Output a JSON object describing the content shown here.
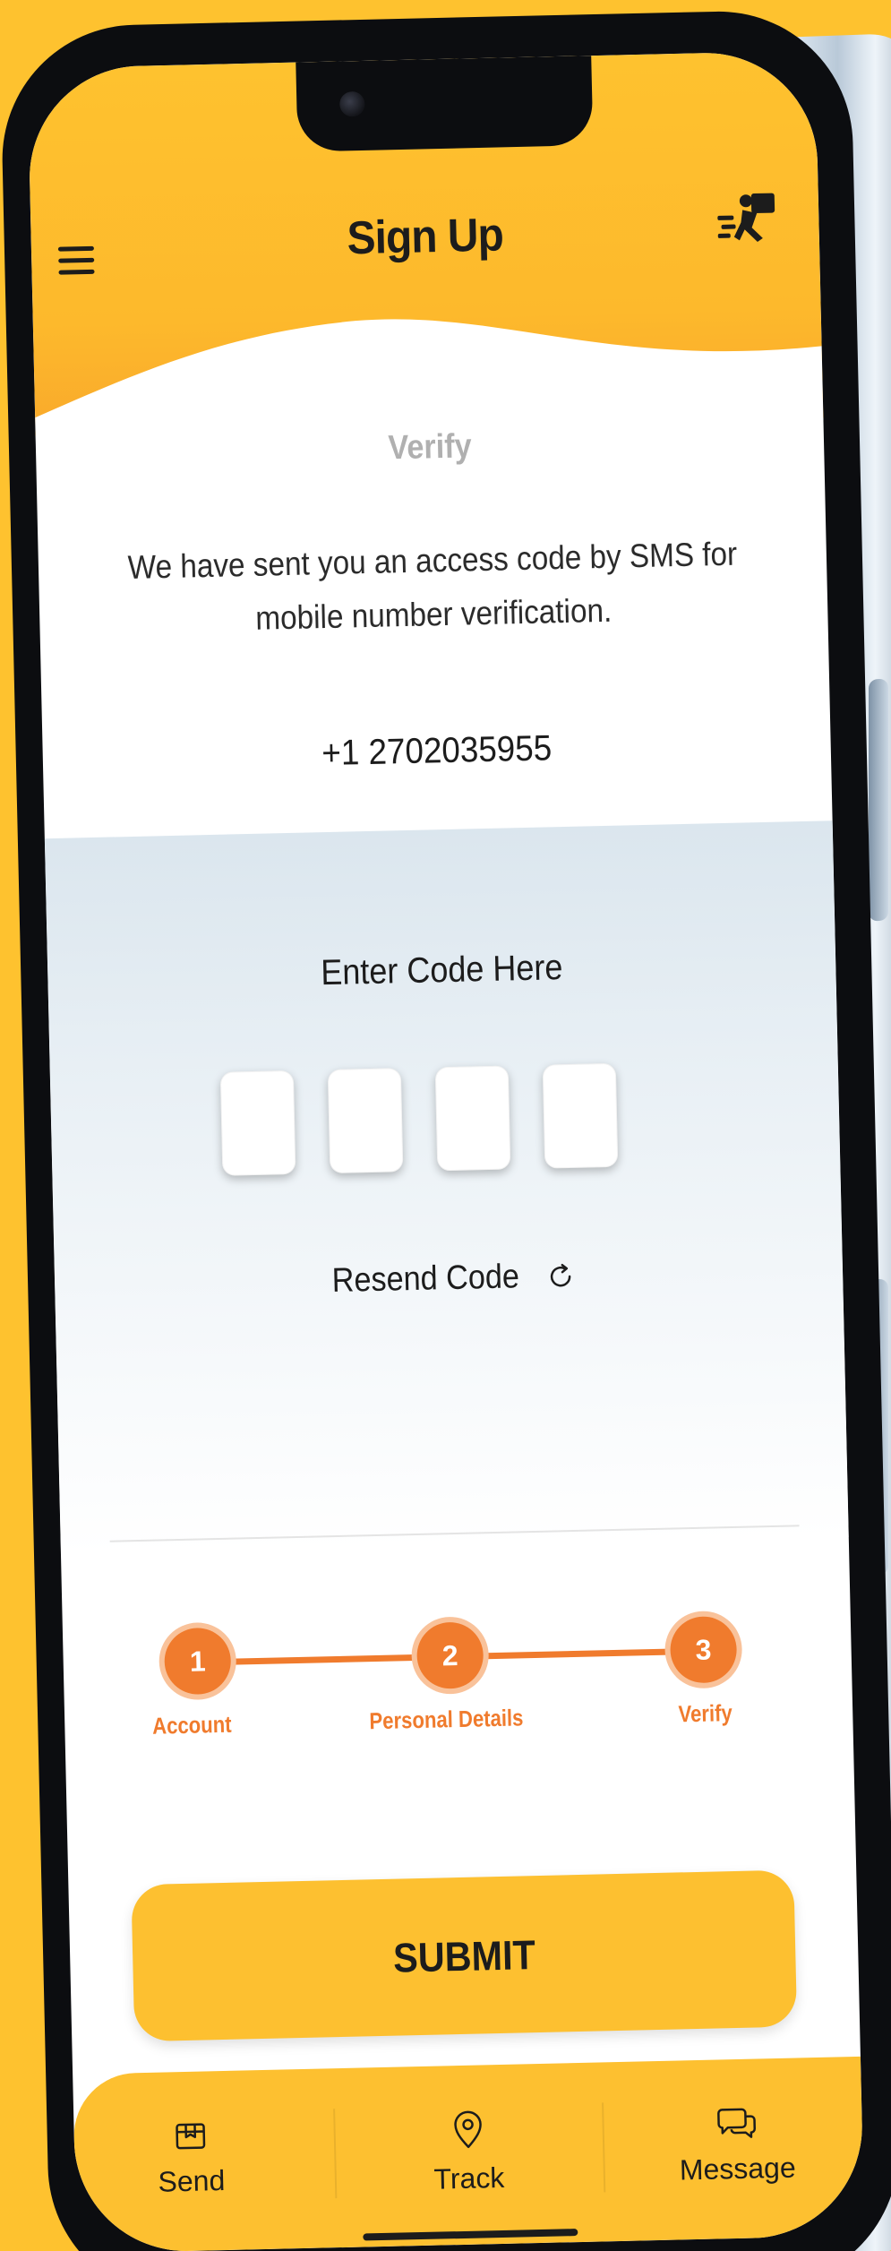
{
  "header": {
    "title": "Sign Up"
  },
  "verify": {
    "title": "Verify",
    "message": "We have sent you an access code by SMS for mobile number verification.",
    "phone_number": "+1 2702035955"
  },
  "code_entry": {
    "title": "Enter Code Here",
    "digits": [
      "",
      "",
      "",
      ""
    ],
    "resend_label": "Resend Code"
  },
  "stepper": {
    "steps": [
      {
        "number": "1",
        "label": "Account"
      },
      {
        "number": "2",
        "label": "Personal Details"
      },
      {
        "number": "3",
        "label": "Verify"
      }
    ],
    "current_step": 3
  },
  "actions": {
    "submit_label": "SUBMIT"
  },
  "bottom_nav": {
    "items": [
      {
        "label": "Send",
        "icon": "package-icon"
      },
      {
        "label": "Track",
        "icon": "location-pin-icon"
      },
      {
        "label": "Message",
        "icon": "chat-bubbles-icon"
      }
    ]
  },
  "colors": {
    "background": "#FEC22F",
    "accent_orange": "#F07B2D",
    "button_yellow": "#FDC030"
  }
}
